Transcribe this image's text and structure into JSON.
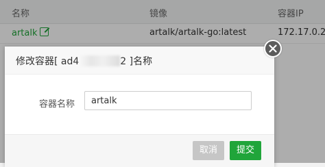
{
  "table": {
    "headers": {
      "name": "名称",
      "image": "镜像",
      "ip": "容器IP"
    },
    "row": {
      "name": "artalk",
      "image": "artalk/artalk-go:latest",
      "ip": "172.17.0.2"
    }
  },
  "dialog": {
    "title_prefix": "修改容器[ ad4",
    "title_suffix": "2 ]名称",
    "field_label": "容器名称",
    "field_value": "artalk",
    "cancel_label": "取消",
    "submit_label": "提交"
  },
  "icons": {
    "edit": "edit-icon",
    "close": "close-icon"
  },
  "colors": {
    "accent": "#20a53a",
    "cancel": "#c6c6c6",
    "close_bg": "#5c5c5c"
  }
}
